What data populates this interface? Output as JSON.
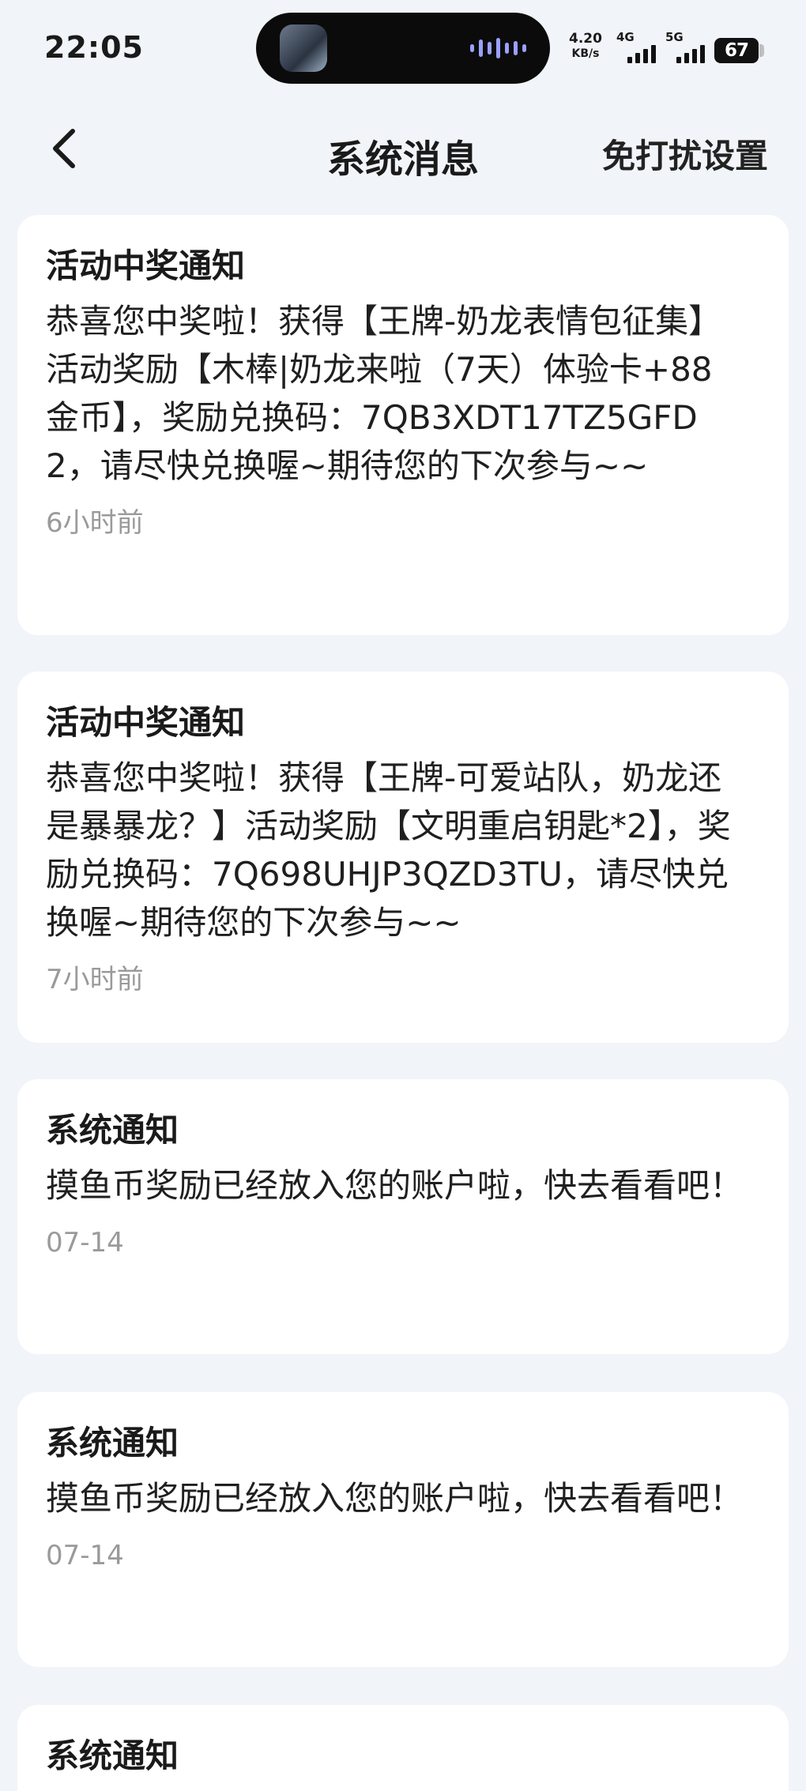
{
  "status_bar": {
    "time": "22:05",
    "net_speed": "4.20",
    "net_unit": "KB/s",
    "sig1_label": "4G",
    "sig2_label": "5G",
    "battery": "67",
    "icons": [
      "island-thumbnail-icon",
      "audio-wave-icon",
      "signal-4g-icon",
      "signal-5g-icon",
      "battery-icon"
    ]
  },
  "navbar": {
    "back_icon": "chevron-left-icon",
    "title": "系统消息",
    "action": "免打扰设置"
  },
  "messages": [
    {
      "title": "活动中奖通知",
      "body": "恭喜您中奖啦！获得【王牌-奶龙表情包征集】活动奖励【木棒|奶龙来啦（7天）体验卡+88金币】，奖励兑换码：7QB3XDT17TZ5GFD2，请尽快兑换喔~期待您的下次参与~~",
      "time": "6小时前"
    },
    {
      "title": "活动中奖通知",
      "body": "恭喜您中奖啦！获得【王牌-可爱站队，奶龙还是暴暴龙？】活动奖励【文明重启钥匙*2】，奖励兑换码：7Q698UHJP3QZD3TU，请尽快兑换喔~期待您的下次参与~~",
      "time": "7小时前"
    },
    {
      "title": "系统通知",
      "body": "摸鱼币奖励已经放入您的账户啦，快去看看吧！",
      "time": "07-14"
    },
    {
      "title": "系统通知",
      "body": "摸鱼币奖励已经放入您的账户啦，快去看看吧！",
      "time": "07-14"
    },
    {
      "title": "系统通知"
    }
  ]
}
